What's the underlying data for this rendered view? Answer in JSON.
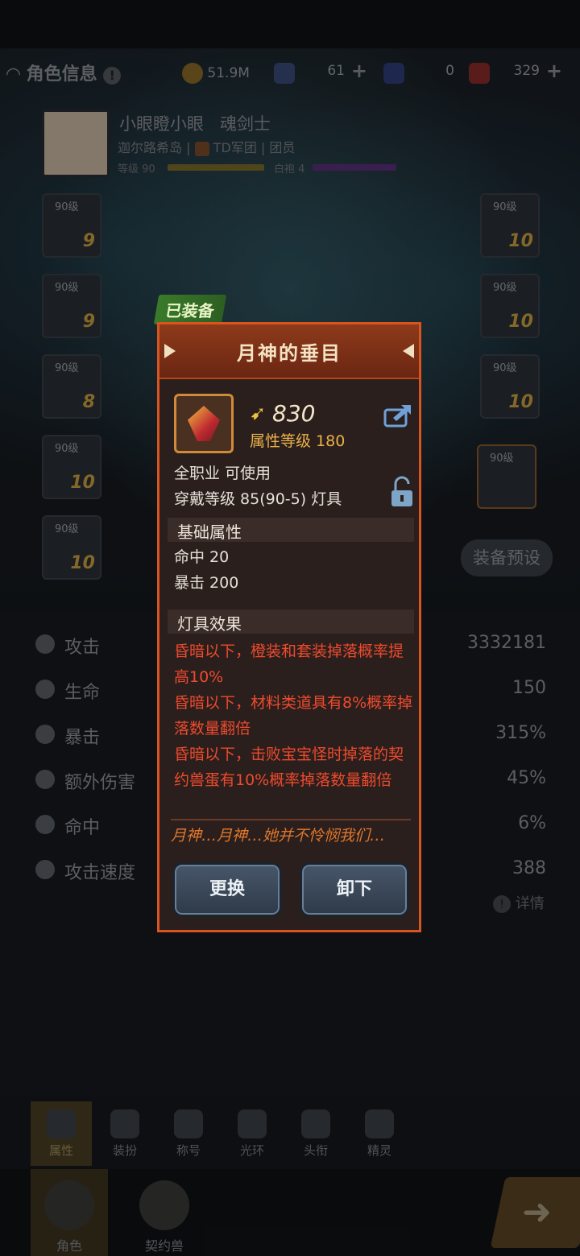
{
  "topbar": {
    "title": "角色信息",
    "gold": "51.9M",
    "crystal": "61",
    "ticket_blue": "0",
    "ticket_red": "329"
  },
  "profile": {
    "name": "小眼瞪小眼",
    "job": "魂剑士",
    "server": "迦尔路希岛 |",
    "guild": "TD军团",
    "role": "| 团员",
    "level_label": "等级 90",
    "robe_label": "白袍 4"
  },
  "slots": {
    "left": [
      {
        "level": "90级",
        "star": "9"
      },
      {
        "level": "90级",
        "star": "9"
      },
      {
        "level": "90级",
        "star": "8"
      },
      {
        "level": "90级",
        "star": "10"
      },
      {
        "level": "90级",
        "star": "10"
      }
    ],
    "right": [
      {
        "level": "90级",
        "star": "10"
      },
      {
        "level": "90级",
        "star": "10"
      },
      {
        "level": "90级",
        "star": "10"
      },
      {
        "level": "90级",
        "star": ""
      }
    ]
  },
  "preset_button": "装备预设",
  "stats": [
    {
      "label": "攻击",
      "value": "3332181"
    },
    {
      "label": "生命",
      "value": "150"
    },
    {
      "label": "暴击",
      "value": "315%"
    },
    {
      "label": "额外伤害",
      "value": "45%"
    },
    {
      "label": "命中",
      "value": "6%"
    },
    {
      "label": "攻击速度",
      "value": "388"
    }
  ],
  "detail_link": "详情",
  "subtabs": [
    "属性",
    "装扮",
    "称号",
    "光环",
    "头衔",
    "精灵"
  ],
  "bottomnav": [
    "角色",
    "契约兽"
  ],
  "equipped_tag": "已装备",
  "modal": {
    "title": "月神的垂目",
    "power": "830",
    "attr_level": "属性等级 180",
    "job_req": "全职业 可使用",
    "wear_req": "穿戴等级 85(90-5) 灯具",
    "base_section": "基础属性",
    "base_stats": [
      "命中 20",
      "暴击 200"
    ],
    "effect_section": "灯具效果",
    "effects": [
      "昏暗以下，橙装和套装掉落概率提高10%",
      "昏暗以下，材料类道具有8%概率掉落数量翻倍",
      "昏暗以下，击败宝宝怪时掉落的契约兽蛋有10%概率掉落数量翻倍"
    ],
    "quote": "月神…月神…她并不怜悯我们…",
    "replace_button": "更换",
    "unequip_button": "卸下"
  },
  "colors": {
    "modal_border": "#d9541e",
    "effect_text": "#ee4a2e",
    "quote_text": "#e0762c",
    "attr_level": "#e9b04a"
  }
}
